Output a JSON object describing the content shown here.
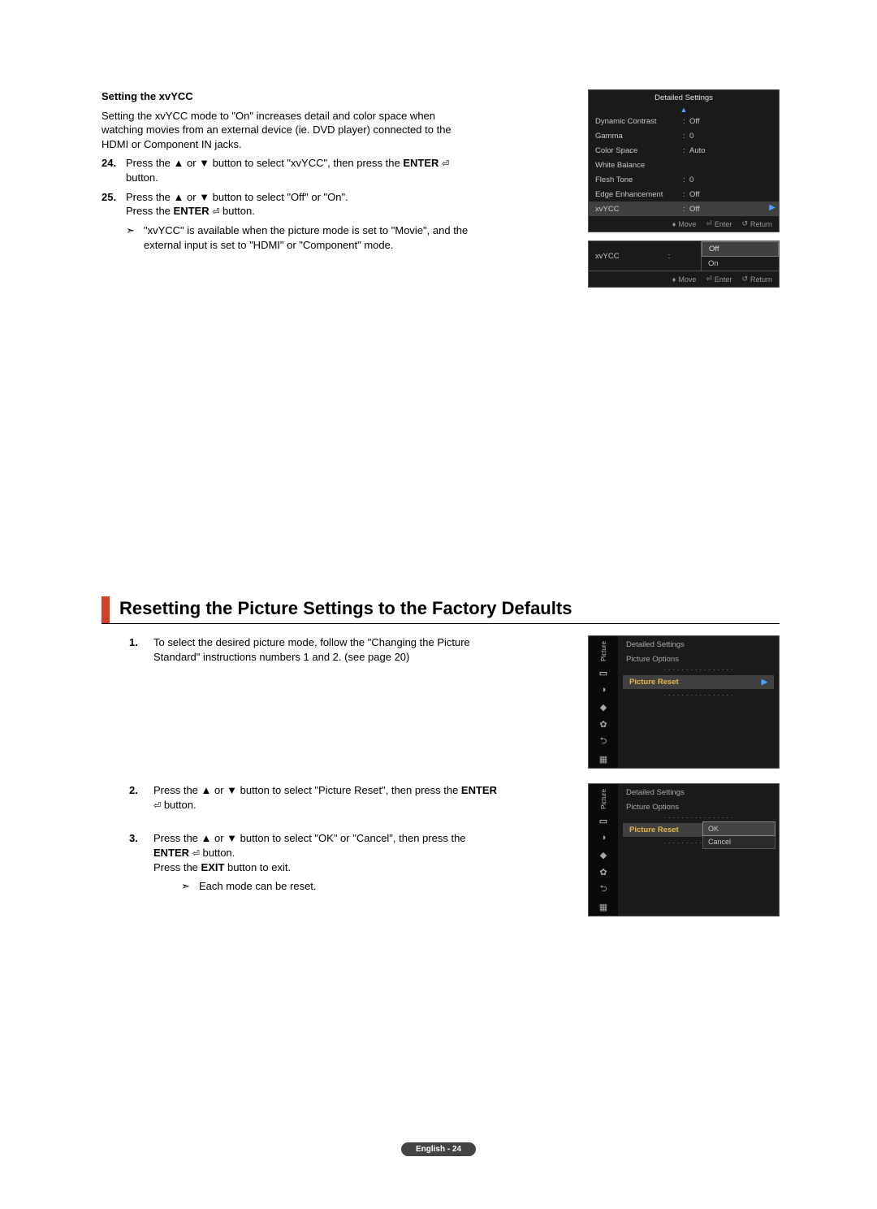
{
  "section1": {
    "heading": "Setting the xvYCC",
    "intro": "Setting the xvYCC mode to \"On\" increases detail and color space when watching movies from an external device (ie. DVD player) connected to the HDMI or Component IN jacks.",
    "step24_num": "24.",
    "step24_a": "Press the ▲ or ▼ button to select \"xvYCC\", then press the ",
    "step24_b": "ENTER",
    "step24_c": " button.",
    "step25_num": "25.",
    "step25_a": "Press the ▲ or ▼ button to select \"Off\" or \"On\".",
    "step25_b": "Press the ",
    "step25_c": "ENTER",
    "step25_d": " button.",
    "note_mark": "➣",
    "note_text": "\"xvYCC\" is available when the picture mode is set to \"Movie\", and the external input is set to \"HDMI\" or \"Component\" mode."
  },
  "osd1": {
    "title": "Detailed Settings",
    "rows": [
      {
        "label": "Dynamic Contrast",
        "value": "Off"
      },
      {
        "label": "Gamma",
        "value": "0"
      },
      {
        "label": "Color Space",
        "value": "Auto"
      },
      {
        "label": "White Balance",
        "value": ""
      },
      {
        "label": "Flesh Tone",
        "value": "0"
      },
      {
        "label": "Edge Enhancement",
        "value": "Off"
      },
      {
        "label": "xvYCC",
        "value": "Off"
      }
    ],
    "footer": {
      "move": "Move",
      "enter": "Enter",
      "return": "Return"
    }
  },
  "osd1b": {
    "label": "xvYCC",
    "opt_off": "Off",
    "opt_on": "On",
    "footer": {
      "move": "Move",
      "enter": "Enter",
      "return": "Return"
    }
  },
  "section2": {
    "title": "Resetting the Picture Settings to the Factory Defaults",
    "step1_num": "1.",
    "step1_text": "To select the desired picture mode, follow the \"Changing the Picture Standard\" instructions numbers 1 and 2. (see page 20)",
    "step2_num": "2.",
    "step2_a": "Press the ▲ or ▼ button to select \"Picture Reset\", then press the ",
    "step2_b": "ENTER",
    "step2_c": " button.",
    "step3_num": "3.",
    "step3_a": "Press the ▲ or ▼ button to select \"OK\" or \"Cancel\", then press the ",
    "step3_b": "ENTER",
    "step3_c": " button.",
    "step3_exit_a": "Press the ",
    "step3_exit_b": "EXIT",
    "step3_exit_c": " button to exit.",
    "note_mark": "➣",
    "note_text": "Each mode can be reset."
  },
  "osd2a": {
    "sidebar_label": "Picture",
    "breadcrumb1": "Detailed Settings",
    "breadcrumb2": "Picture Options",
    "item": "Picture Reset"
  },
  "osd2b": {
    "sidebar_label": "Picture",
    "breadcrumb1": "Detailed Settings",
    "breadcrumb2": "Picture Options",
    "item": "Picture Reset",
    "opt_ok": "OK",
    "opt_cancel": "Cancel"
  },
  "footer": "English - 24"
}
